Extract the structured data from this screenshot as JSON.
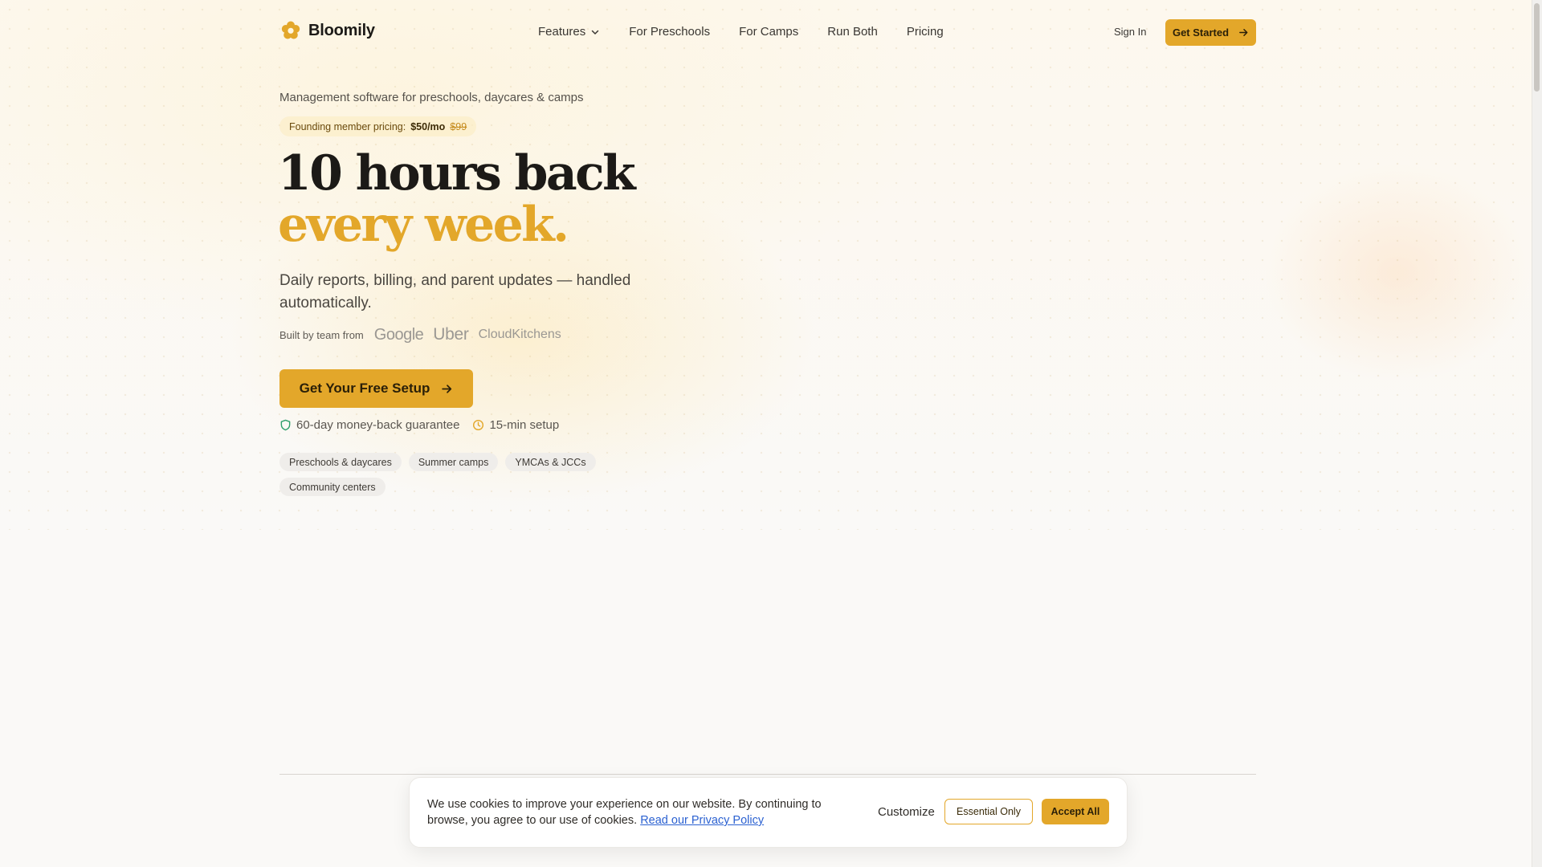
{
  "colors": {
    "accent": "#e3a72a",
    "background": "#faf9f7",
    "link": "#2b61d1",
    "shield": "#2e9f6b"
  },
  "nav": {
    "brand": "Bloomily",
    "logo_icon": "flower-logo-icon",
    "links": [
      "Features",
      "For Preschools",
      "For Camps",
      "Run Both",
      "Pricing"
    ],
    "sign_in": "Sign In",
    "get_started": "Get Started"
  },
  "hero": {
    "eyebrow": "Management software for preschools, daycares & camps",
    "promo": {
      "label": "Founding member pricing:",
      "price": "$50/mo",
      "old_price": "$99"
    },
    "headline_line1": "10 hours back",
    "headline_line2": "every week.",
    "subheadline": "Daily reports, billing, and parent updates — handled automatically.",
    "built_label": "Built by team from",
    "brands": [
      "Google",
      "Uber",
      "CloudKitchens"
    ],
    "cta": "Get Your Free Setup",
    "guarantees": [
      "60-day money-back guarantee",
      "15-min setup"
    ],
    "audiences": [
      "Preschools & daycares",
      "Summer camps",
      "YMCAs & JCCs",
      "Community centers"
    ]
  },
  "cookie": {
    "message": "We use cookies to improve your experience on our website. By continuing to browse, you agree to our use of cookies.",
    "link": "Read our Privacy Policy",
    "customize": "Customize",
    "essential": "Essential Only",
    "accept": "Accept All"
  }
}
